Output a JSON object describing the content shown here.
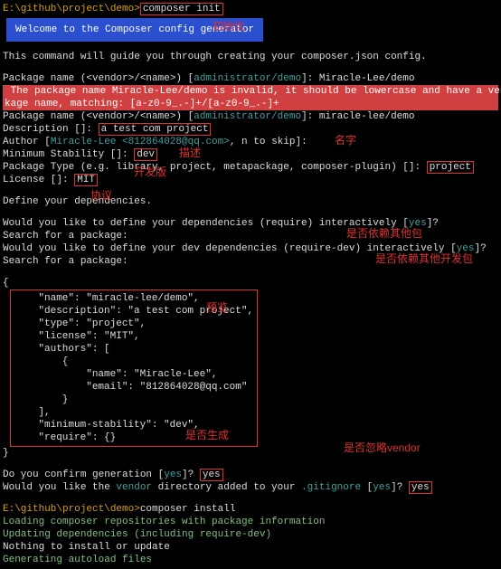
{
  "prompt": {
    "path": "E:\\github\\project\\demo>",
    "cmd1": "composer init",
    "cmd2": "composer install"
  },
  "banner": "Welcome to the Composer config generator",
  "intro": "This command will guide you through creating your composer.json config.",
  "pkg_label1": "Package name (<vendor>/<name>) [",
  "admin_demo": "administrator/demo",
  "pkg_input1": "]: Miracle-Lee/demo",
  "err1": " The package name Miracle-Lee/demo is invalid, it should be lowercase and have a vendor name, a forward slash,",
  "err2": "kage name, matching: [a-z0-9_.-]+/[a-z0-9_.-]+",
  "pkg_input2": "]: miracle-lee/demo",
  "desc_label": "Description []: ",
  "desc_val": "a test com project",
  "author_label": "Author [",
  "author_val": "Miracle-Lee <812864028@qq.com>",
  "author_tail": ", n to skip]:",
  "stab_label": "Minimum Stability []: ",
  "stab_val": "dev",
  "type_label": "Package Type (e.g. library, project, metapackage, composer-plugin) []: ",
  "type_val": "project",
  "lic_label": "License []: ",
  "lic_val": "MIT",
  "define_deps": "Define your dependencies.",
  "req_q": "Would you like to define your dependencies (require) interactively [",
  "yes": "yes",
  "qmark": "]?",
  "search": "Search for a package:",
  "reqdev_q": "Would you like to define your dev dependencies (require-dev) interactively [",
  "json": {
    "l1": "    \"name\": \"miracle-lee/demo\",",
    "l2": "    \"description\": \"a test com project\",",
    "l3": "    \"type\": \"project\",",
    "l4": "    \"license\": \"MIT\",",
    "l5": "    \"authors\": [",
    "l6": "        {",
    "l7": "            \"name\": \"Miracle-Lee\",",
    "l8": "            \"email\": \"812864028@qq.com\"",
    "l9": "        }",
    "l10": "    ],",
    "l11": "    \"minimum-stability\": \"dev\",",
    "l12": "    \"require\": {}"
  },
  "confirm_q": "Do you confirm generation [",
  "vendor_q1": "Would you like the ",
  "vendor_word": "vendor",
  "vendor_q2": " directory added to your ",
  "gitignore": ".gitignore",
  "vendor_q3": " [",
  "install1": "Loading composer repositories with package information",
  "install2": "Updating dependencies (including require-dev)",
  "install3": "Nothing to install or update",
  "install4": "Generating autoload files",
  "ann": {
    "init": "初始化",
    "desc": "描述",
    "name": "名字",
    "dev": "开发版",
    "license": "协议",
    "depother": "是否依赖其他包",
    "depdev": "是否依赖其他开发包",
    "preview": "预览",
    "gen": "是否生成",
    "ignore": "是否忽略vendor"
  }
}
